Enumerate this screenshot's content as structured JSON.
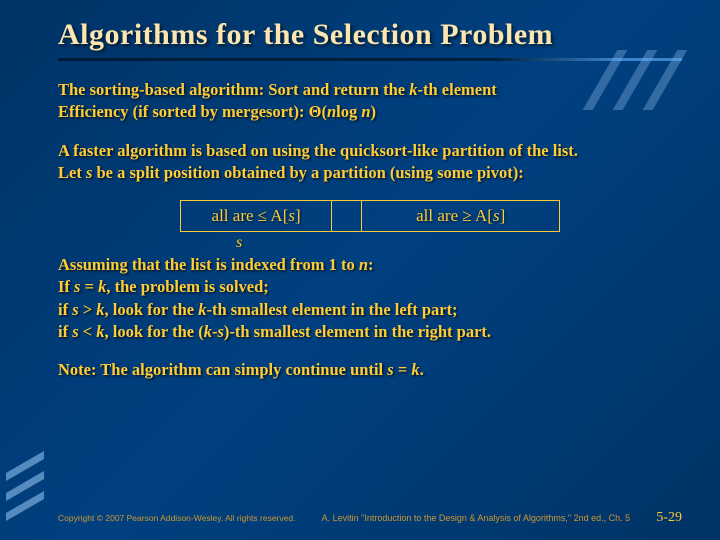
{
  "title": "Algorithms for the Selection Problem",
  "p1a": "The sorting-based algorithm: Sort and return the ",
  "p1b": "-th element",
  "p1c": "Efficiency (if sorted by mergesort): Θ(",
  "p1d": "log ",
  "p1e": ")",
  "p2a": "A faster algorithm is based on using the quicksort-like partition of the list.",
  "p2b": "Let ",
  "p2c": " be a split position obtained by a partition (using some pivot):",
  "diag": {
    "left_a": "all are ≤ A[",
    "left_b": "]",
    "right_a": "all are ≥ A[",
    "right_b": "]",
    "s": "s"
  },
  "p3a": "Assuming that the list is indexed from 1 to ",
  "p3b": ":",
  "p4a": "If ",
  "p4b": " = ",
  "p4c": ", the problem is solved;",
  "p5a": "if ",
  "p5b": " > ",
  "p5c": ", look for the ",
  "p5d": "-th smallest element in the left part;",
  "p6a": "if ",
  "p6b": " < ",
  "p6c": ", look for the (",
  "p6d": "-",
  "p6e": ")-th smallest element in the right part.",
  "p7a": "Note: The algorithm can simply continue until ",
  "p7b": " = ",
  "p7c": ".",
  "vars": {
    "k": "k",
    "n": "n",
    "s": "s"
  },
  "footer": {
    "copyright": "Copyright © 2007 Pearson Addison-Wesley. All rights reserved.",
    "attribution": "A. Levitin \"Introduction to the Design & Analysis of Algorithms,\" 2nd ed., Ch. 5",
    "page": "5-29"
  }
}
